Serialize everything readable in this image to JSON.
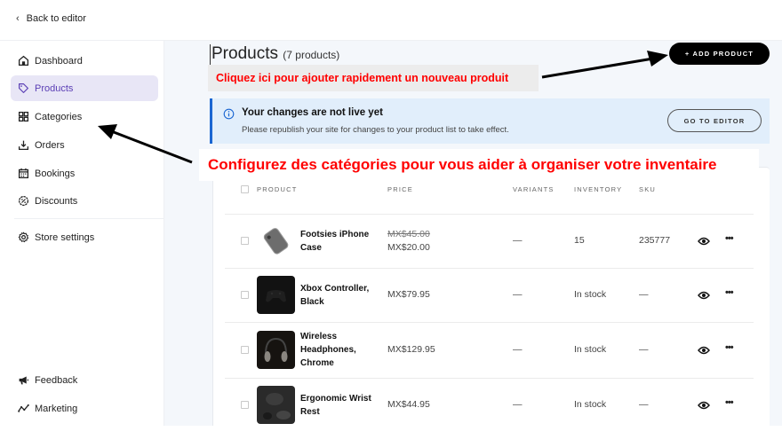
{
  "topbar": {
    "back_label": "Back to editor"
  },
  "sidebar": {
    "items": [
      {
        "label": "Dashboard",
        "icon": "home-icon",
        "active": false
      },
      {
        "label": "Products",
        "icon": "tag-icon",
        "active": true
      },
      {
        "label": "Categories",
        "icon": "grid-icon",
        "active": false
      },
      {
        "label": "Orders",
        "icon": "download-tray-icon",
        "active": false
      },
      {
        "label": "Bookings",
        "icon": "calendar-icon",
        "active": false
      },
      {
        "label": "Discounts",
        "icon": "discount-badge-icon",
        "active": false
      },
      {
        "label": "Store settings",
        "icon": "gear-icon",
        "active": false
      }
    ],
    "bottom_items": [
      {
        "label": "Feedback",
        "icon": "megaphone-icon"
      },
      {
        "label": "Marketing",
        "icon": "trend-icon"
      }
    ]
  },
  "header": {
    "title": "Products",
    "count": "(7 products)",
    "add_button": "+ ADD PRODUCT"
  },
  "annotations": {
    "add_product_hint": "Cliquez ici pour ajouter rapidement un nouveau produit",
    "categories_hint": "Configurez des catégories pour vous aider à organiser votre inventaire",
    "color": "#ff0000"
  },
  "notice": {
    "title": "Your changes are not live yet",
    "body": "Please republish your site for changes to your product list to take effect.",
    "button": "GO TO EDITOR",
    "accent": "#1a66d2"
  },
  "table": {
    "columns": [
      "PRODUCT",
      "PRICE",
      "VARIANTS",
      "INVENTORY",
      "SKU"
    ],
    "rows": [
      {
        "name": "Footsies iPhone Case",
        "old_price": "MX$45.00",
        "price": "MX$20.00",
        "variants": "—",
        "inventory": "15",
        "sku": "235777"
      },
      {
        "name": "Xbox Controller, Black",
        "old_price": "",
        "price": "MX$79.95",
        "variants": "—",
        "inventory": "In stock",
        "sku": "—"
      },
      {
        "name": "Wireless Headphones, Chrome",
        "old_price": "",
        "price": "MX$129.95",
        "variants": "—",
        "inventory": "In stock",
        "sku": "—"
      },
      {
        "name": "Ergonomic Wrist Rest",
        "old_price": "",
        "price": "MX$44.95",
        "variants": "—",
        "inventory": "In stock",
        "sku": "—"
      }
    ]
  },
  "colors": {
    "active_nav_bg": "#e8e6f6",
    "active_nav_text": "#5b3fb5",
    "notice_bg": "#e1eefb",
    "primary_button": "#000000"
  }
}
